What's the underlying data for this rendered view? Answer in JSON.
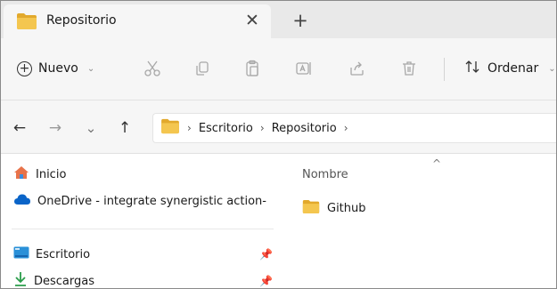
{
  "tab": {
    "title": "Repositorio",
    "close_glyph": "✕",
    "new_tab_glyph": "+"
  },
  "toolbar": {
    "new_label": "Nuevo",
    "sort_label": "Ordenar",
    "icons": [
      "cut-icon",
      "copy-icon",
      "paste-icon",
      "rename-icon",
      "share-icon",
      "delete-icon"
    ]
  },
  "nav": {
    "back_glyph": "←",
    "forward_glyph": "→",
    "recent_glyph": "⌄",
    "up_glyph": "↑",
    "breadcrumb": [
      "Escritorio",
      "Repositorio"
    ],
    "separator": "›"
  },
  "sidebar": {
    "items": [
      {
        "label": "Inicio",
        "icon": "home-icon"
      },
      {
        "label": "OneDrive - integrate synergistic action-",
        "icon": "cloud-icon"
      },
      {
        "label": "Escritorio",
        "icon": "desktop-icon",
        "pinned": true
      },
      {
        "label": "Descargas",
        "icon": "download-icon",
        "pinned": true
      }
    ]
  },
  "content": {
    "column_header": "Nombre",
    "sort_caret": "^",
    "files": [
      {
        "name": "Github",
        "icon": "folder-icon"
      }
    ]
  },
  "colors": {
    "folder": "#f4c64f",
    "folder_dark": "#e2a92c",
    "accent": "#0a64c8",
    "home": "#e8734a"
  }
}
